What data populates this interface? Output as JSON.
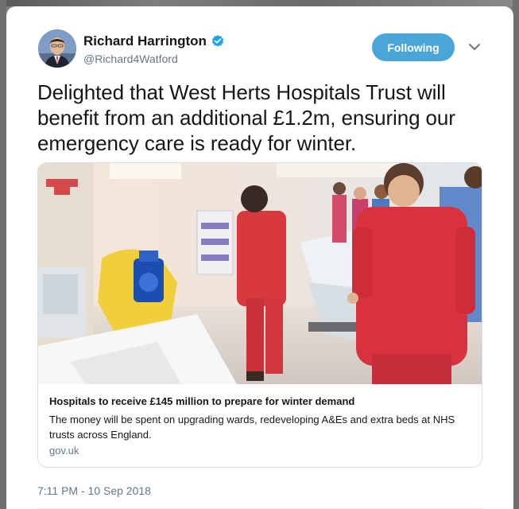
{
  "author": {
    "name": "Richard Harrington",
    "handle": "@Richard4Watford",
    "verified_icon": "verified-badge-icon",
    "avatar_icon": "avatar"
  },
  "follow_button": {
    "label": "Following",
    "color": "#4aa6d8"
  },
  "menu": {
    "icon": "chevron-down-icon"
  },
  "tweet": {
    "text": "Delighted that West Herts Hospitals Trust will benefit from an additional £1.2m, ensuring our emergency care is ready for winter.",
    "timestamp": "7:11 PM - 10 Sep 2018"
  },
  "link_card": {
    "title": "Hospitals to receive £145 million to prepare for winter demand",
    "description": "The money will be spent on upgrading wards, redeveloping A&Es and extra beds at NHS trusts across England.",
    "domain": "gov.uk",
    "image_subject": "hospital-corridor-photo"
  },
  "colors": {
    "text_primary": "#14171a",
    "text_secondary": "#657786",
    "verified_blue": "#1da1f2",
    "border": "#d7dde2"
  }
}
